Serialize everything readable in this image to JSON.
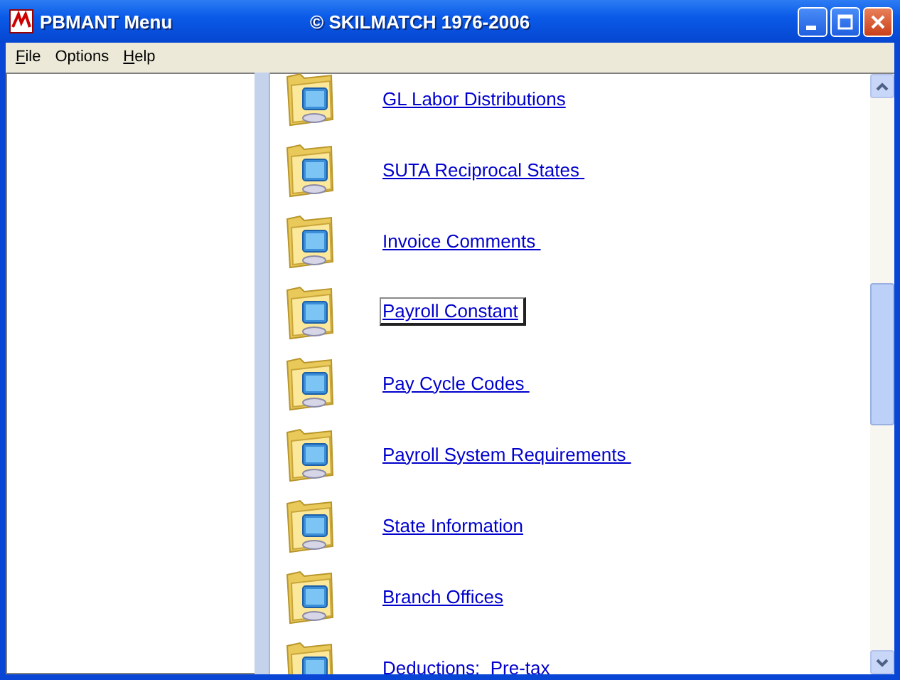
{
  "window": {
    "title": "PBMANT Menu",
    "subtitle": "© SKILMATCH 1976-2006"
  },
  "menu": [
    {
      "label": "File",
      "underline_first": true
    },
    {
      "label": "Options",
      "underline_first": false
    },
    {
      "label": "Help",
      "underline_first": true
    }
  ],
  "items": [
    {
      "label": "GL Labor Distributions",
      "selected": false
    },
    {
      "label": "SUTA Reciprocal States ",
      "selected": false
    },
    {
      "label": "Invoice Comments ",
      "selected": false
    },
    {
      "label": "Payroll Constant",
      "selected": true
    },
    {
      "label": "Pay Cycle Codes ",
      "selected": false
    },
    {
      "label": "Payroll System Requirements ",
      "selected": false
    },
    {
      "label": "State Information",
      "selected": false
    },
    {
      "label": "Branch Offices",
      "selected": false
    },
    {
      "label": "Deductions:  Pre-tax",
      "selected": false
    }
  ]
}
